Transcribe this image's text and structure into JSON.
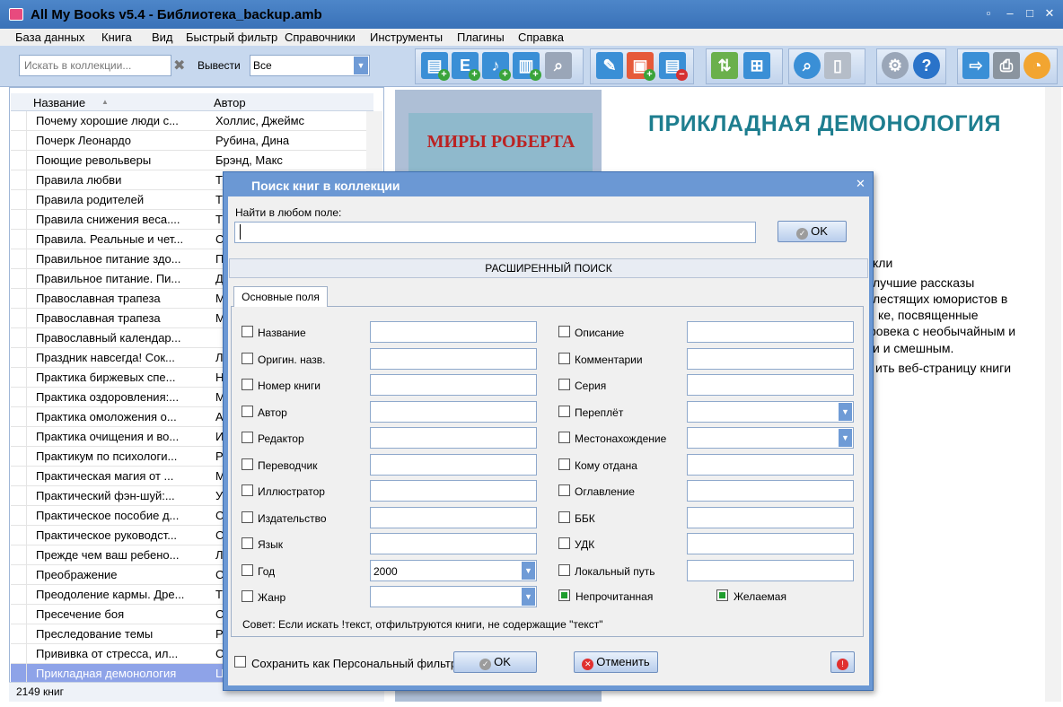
{
  "window": {
    "title": "All My Books v5.4 - Библиотека_backup.amb"
  },
  "menu": [
    "База данных",
    "Книга",
    "Вид",
    "Быстрый фильтр",
    "Справочники",
    "Инструменты",
    "Плагины",
    "Справка"
  ],
  "toolbar": {
    "search_placeholder": "Искать в коллекции...",
    "output_label": "Вывести",
    "output_value": "Все"
  },
  "list": {
    "col_name": "Название",
    "col_author": "Автор",
    "rows": [
      {
        "name": "Почему хорошие люди с...",
        "author": "Холлис, Джеймс"
      },
      {
        "name": "Почерк Леонардо",
        "author": "Рубина, Дина"
      },
      {
        "name": "Поющие револьверы",
        "author": "Брэнд, Макс"
      },
      {
        "name": "Правила любви",
        "author": "Т"
      },
      {
        "name": "Правила родителей",
        "author": "Т"
      },
      {
        "name": "Правила снижения веса....",
        "author": "Т"
      },
      {
        "name": "Правила. Реальные и чет...",
        "author": "С"
      },
      {
        "name": "Правильное питание здо...",
        "author": "П"
      },
      {
        "name": "Правильное питание. Пи...",
        "author": "Д"
      },
      {
        "name": "Православная трапеза",
        "author": "М"
      },
      {
        "name": "Православная трапеза",
        "author": "М"
      },
      {
        "name": "Православный календар...",
        "author": ""
      },
      {
        "name": "Праздник навсегда! Сок...",
        "author": "Л"
      },
      {
        "name": "Практика биржевых спе...",
        "author": "Н"
      },
      {
        "name": "Практика оздоровления:...",
        "author": "М"
      },
      {
        "name": "Практика омоложения о...",
        "author": "А"
      },
      {
        "name": "Практика очищения и во...",
        "author": "И"
      },
      {
        "name": "Практикум по психологи...",
        "author": "Р"
      },
      {
        "name": "Практическая магия от ...",
        "author": "М"
      },
      {
        "name": "Практический фэн-шуй:...",
        "author": "У"
      },
      {
        "name": "Практическое пособие д...",
        "author": "С"
      },
      {
        "name": "Практическое руководст...",
        "author": "С"
      },
      {
        "name": "Прежде чем ваш ребено...",
        "author": "Л"
      },
      {
        "name": "Преображение",
        "author": "С"
      },
      {
        "name": "Преодоление кармы. Дре...",
        "author": "Т"
      },
      {
        "name": "Пресечение боя",
        "author": "С"
      },
      {
        "name": "Преследование темы",
        "author": "Р"
      },
      {
        "name": "Прививка от стресса, ил...",
        "author": "С"
      },
      {
        "name": "Прикладная демонология",
        "author": "Ц"
      }
    ],
    "status": "2149 книг"
  },
  "detail": {
    "cover_text": "МИРЫ РОБЕРТА",
    "book_title": "ПРИКЛАДНАЯ ДЕМОНОЛОГИЯ",
    "desc_lines": [
      "кли",
      "лучшие рассказы",
      "лестящих юмористов в",
      "ке, посвященные",
      "ровека с необычайным и",
      "и и смешным."
    ],
    "web_link": "ить веб-страницу книги"
  },
  "dialog": {
    "title": "Поиск книг в коллекции",
    "find_label": "Найти в любом поле:",
    "ok_label": "OK",
    "advanced_label": "РАСШИРЕННЫЙ ПОИСК",
    "tab_label": "Основные поля",
    "left_fields": [
      {
        "label": "Название",
        "value": ""
      },
      {
        "label": "Оригин. назв.",
        "value": ""
      },
      {
        "label": "Номер книги",
        "value": ""
      },
      {
        "label": "Автор",
        "value": ""
      },
      {
        "label": "Редактор",
        "value": ""
      },
      {
        "label": "Переводчик",
        "value": ""
      },
      {
        "label": "Иллюстратор",
        "value": ""
      },
      {
        "label": "Издательство",
        "value": ""
      },
      {
        "label": "Язык",
        "value": ""
      },
      {
        "label": "Год",
        "value": "2000"
      },
      {
        "label": "Жанр",
        "value": ""
      }
    ],
    "right_fields": [
      {
        "label": "Описание",
        "value": ""
      },
      {
        "label": "Комментарии",
        "value": ""
      },
      {
        "label": "Серия",
        "value": ""
      },
      {
        "label": "Переплёт",
        "value": ""
      },
      {
        "label": "Местонахождение",
        "value": ""
      },
      {
        "label": "Кому отдана",
        "value": ""
      },
      {
        "label": "Оглавление",
        "value": ""
      },
      {
        "label": "ББК",
        "value": ""
      },
      {
        "label": "УДК",
        "value": ""
      },
      {
        "label": "Локальный путь",
        "value": ""
      }
    ],
    "unread_label": "Непрочитанная",
    "wanted_label": "Желаемая",
    "hint": "Совет: Если искать !текст, отфильтруются книги, не содержащие \"текст\"",
    "save_filter_label": "Сохранить как Персональный фильтр",
    "bottom_ok_label": "OK",
    "cancel_label": "Отменить"
  }
}
